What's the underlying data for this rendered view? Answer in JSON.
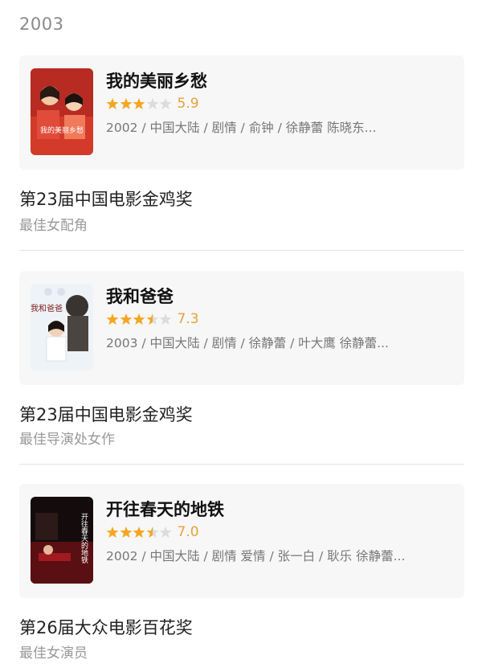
{
  "year": "2003",
  "entries": [
    {
      "title": "我的美丽乡愁",
      "rating": 5.9,
      "score_text": "5.9",
      "star_fill": 0.6,
      "meta": "2002 / 中国大陆 / 剧情 / 俞钟 / 徐静蕾 陈晓东...",
      "poster_text": "我的美丽乡愁",
      "award": "第23届中国电影金鸡奖",
      "category": "最佳女配角"
    },
    {
      "title": "我和爸爸",
      "rating": 7.3,
      "score_text": "7.3",
      "star_fill": 0.7,
      "meta": "2003 / 中国大陆 / 剧情 / 徐静蕾 / 叶大鹰 徐静蕾...",
      "poster_text": "我和爸爸",
      "award": "第23届中国电影金鸡奖",
      "category": "最佳导演处女作"
    },
    {
      "title": "开往春天的地铁",
      "rating": 7.0,
      "score_text": "7.0",
      "star_fill": 0.7,
      "meta": "2002 / 中国大陆 / 剧情 爱情 / 张一白 / 耿乐 徐静蕾...",
      "poster_text": "开往春天的地铁",
      "award": "第26届大众电影百花奖",
      "category": "最佳女演员"
    }
  ],
  "colors": {
    "star_on": "#f5a623",
    "star_off": "#dcdcdc",
    "score": "#e6a23c"
  }
}
